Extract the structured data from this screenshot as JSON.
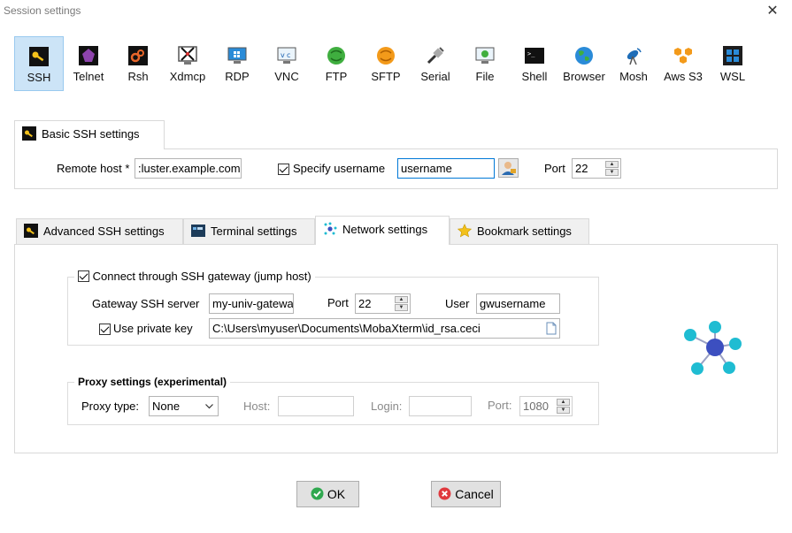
{
  "window": {
    "title": "Session settings",
    "close": "✕"
  },
  "protocols": [
    {
      "label": "SSH",
      "icon": "ssh-key-icon",
      "selected": true
    },
    {
      "label": "Telnet",
      "icon": "telnet-icon"
    },
    {
      "label": "Rsh",
      "icon": "rsh-icon"
    },
    {
      "label": "Xdmcp",
      "icon": "xdmcp-icon"
    },
    {
      "label": "RDP",
      "icon": "rdp-icon"
    },
    {
      "label": "VNC",
      "icon": "vnc-icon"
    },
    {
      "label": "FTP",
      "icon": "ftp-icon"
    },
    {
      "label": "SFTP",
      "icon": "sftp-icon"
    },
    {
      "label": "Serial",
      "icon": "serial-icon"
    },
    {
      "label": "File",
      "icon": "file-icon"
    },
    {
      "label": "Shell",
      "icon": "shell-icon"
    },
    {
      "label": "Browser",
      "icon": "browser-icon"
    },
    {
      "label": "Mosh",
      "icon": "mosh-icon"
    },
    {
      "label": "Aws S3",
      "icon": "aws-s3-icon"
    },
    {
      "label": "WSL",
      "icon": "wsl-icon"
    }
  ],
  "basic": {
    "tab_label": "Basic SSH settings",
    "remote_host_label": "Remote host *",
    "remote_host_value": ":luster.example.com",
    "specify_username_label": "Specify username",
    "username_value": "username",
    "port_label": "Port",
    "port_value": "22"
  },
  "tabs": [
    {
      "label": "Advanced SSH settings",
      "icon": "wrench-key-icon"
    },
    {
      "label": "Terminal settings",
      "icon": "terminal-icon"
    },
    {
      "label": "Network settings",
      "icon": "network-icon",
      "active": true
    },
    {
      "label": "Bookmark settings",
      "icon": "star-icon"
    }
  ],
  "network": {
    "gateway_checkbox_label": "Connect through SSH gateway (jump host)",
    "gateway_server_label": "Gateway SSH server",
    "gateway_server_value": "my-univ-gatewa",
    "port_label": "Port",
    "port_value": "22",
    "user_label": "User",
    "user_value": "gwusername",
    "private_key_label": "Use private key",
    "private_key_value": "C:\\Users\\myuser\\Documents\\MobaXterm\\id_rsa.ceci",
    "proxy_group_label": "Proxy settings (experimental)",
    "proxy_type_label": "Proxy type:",
    "proxy_type_value": "None",
    "host_label": "Host:",
    "login_label": "Login:",
    "proxy_port_label": "Port:",
    "proxy_port_value": "1080"
  },
  "buttons": {
    "ok": "OK",
    "cancel": "Cancel"
  },
  "colors": {
    "selected_bg": "#cce4f7",
    "accent": "#0078d7",
    "network_node": "#1fbcd2",
    "network_hub": "#3c4fc0"
  }
}
